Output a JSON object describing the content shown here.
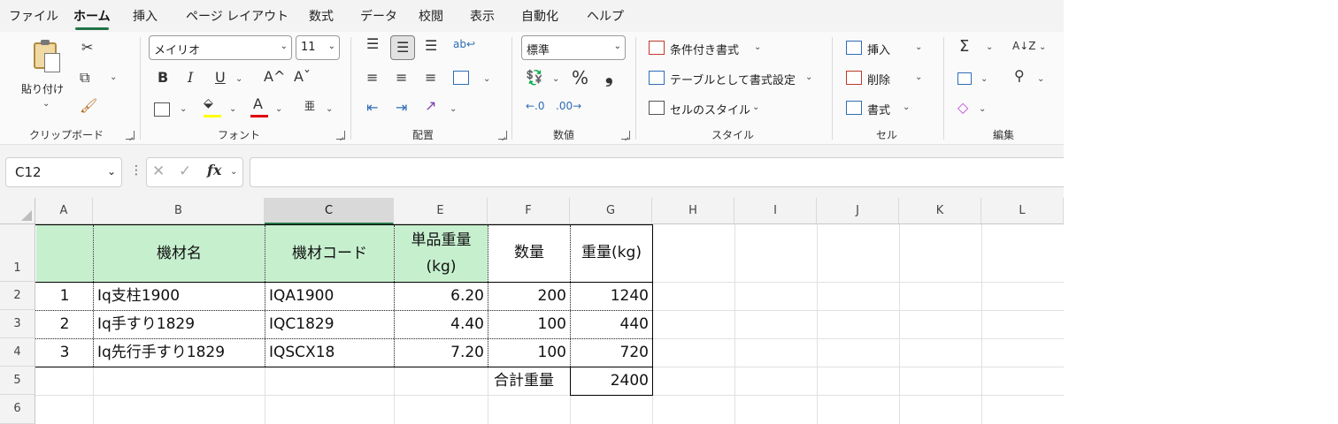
{
  "menu": {
    "tabs": [
      {
        "label": "ファイル",
        "active": false
      },
      {
        "label": "ホーム",
        "active": true
      },
      {
        "label": "挿入",
        "active": false
      },
      {
        "label": "ページ レイアウト",
        "active": false
      },
      {
        "label": "数式",
        "active": false
      },
      {
        "label": "データ",
        "active": false
      },
      {
        "label": "校閲",
        "active": false
      },
      {
        "label": "表示",
        "active": false
      },
      {
        "label": "自動化",
        "active": false
      },
      {
        "label": "ヘルプ",
        "active": false
      }
    ]
  },
  "ribbon": {
    "clipboard": {
      "paste_label": "貼り付け",
      "group_label": "クリップボード"
    },
    "font": {
      "font_name": "メイリオ",
      "font_size": "11",
      "bold": "B",
      "italic": "I",
      "underline": "U",
      "grow": "A^",
      "shrink": "Aˇ",
      "font_color_glyph": "A",
      "phonetic_glyph": "亜",
      "group_label": "フォント"
    },
    "alignment": {
      "group_label": "配置"
    },
    "number": {
      "format": "標準",
      "percent": "%",
      "comma": "❟",
      "group_label": "数値"
    },
    "styles": {
      "conditional": "条件付き書式",
      "table": "テーブルとして書式設定",
      "cell_styles": "セルのスタイル",
      "group_label": "スタイル"
    },
    "cells": {
      "insert": "挿入",
      "delete": "削除",
      "format": "書式",
      "group_label": "セル"
    },
    "editing": {
      "sum": "Σ",
      "group_label": "編集"
    }
  },
  "formula_bar": {
    "name_box": "C12",
    "cancel_glyph": "✕",
    "enter_glyph": "✓",
    "fx": "fx",
    "value": ""
  },
  "columns": [
    "A",
    "B",
    "C",
    "E",
    "F",
    "G",
    "H",
    "I",
    "J",
    "K",
    "L"
  ],
  "selected_column": "C",
  "rows": [
    "1",
    "2",
    "3",
    "4",
    "5",
    "6"
  ],
  "sheet": {
    "headers": {
      "b": "機材名",
      "c": "機材コード",
      "e_line1": "単品重量",
      "e_line2": "(kg)",
      "f": "数量",
      "g": "重量(kg)"
    },
    "data": [
      {
        "a": "1",
        "b": "Iq支柱1900",
        "c": "IQA1900",
        "e": "6.20",
        "f": "200",
        "g": "1240"
      },
      {
        "a": "2",
        "b": "Iq手すり1829",
        "c": "IQC1829",
        "e": "4.40",
        "f": "100",
        "g": "440"
      },
      {
        "a": "3",
        "b": "Iq先行手すり1829",
        "c": "IQSCX18",
        "e": "7.20",
        "f": "100",
        "g": "720"
      }
    ],
    "total_label": "合計重量",
    "total_value": "2400"
  },
  "colors": {
    "accent": "#217346",
    "header_fill": "#c6efce"
  }
}
